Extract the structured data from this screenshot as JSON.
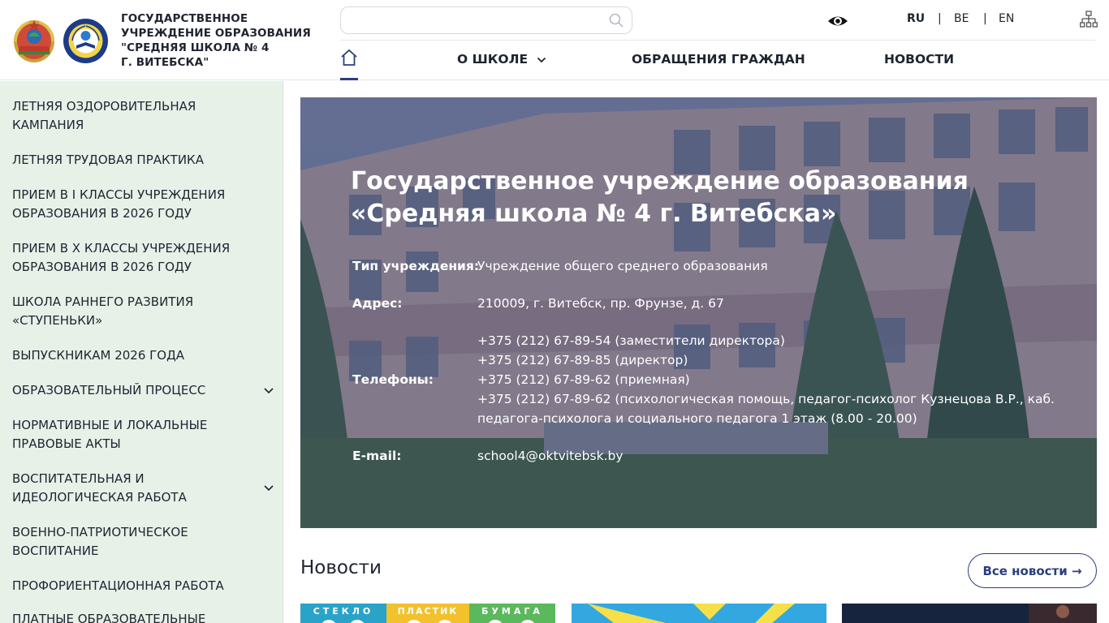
{
  "header": {
    "brand_lines": [
      "ГОСУДАРСТВЕННОЕ",
      "УЧРЕЖДЕНИЕ ОБРАЗОВАНИЯ",
      "\"СРЕДНЯЯ ШКОЛА № 4",
      "Г. ВИТЕБСКА\""
    ],
    "search": {
      "placeholder": ""
    },
    "languages": [
      {
        "code": "RU",
        "active": true
      },
      {
        "code": "BE",
        "active": false
      },
      {
        "code": "EN",
        "active": false
      }
    ],
    "lang_separator": "|"
  },
  "nav": {
    "items": [
      {
        "label": "О ШКОЛЕ",
        "has_dropdown": true
      },
      {
        "label": "ОБРАЩЕНИЯ ГРАЖДАН",
        "has_dropdown": false
      },
      {
        "label": "НОВОСТИ",
        "has_dropdown": false
      }
    ]
  },
  "sidebar": {
    "items": [
      {
        "label": "ЛЕТНЯЯ ОЗДОРОВИТЕЛЬНАЯ КАМПАНИЯ",
        "expandable": false
      },
      {
        "label": "ЛЕТНЯЯ ТРУДОВАЯ ПРАКТИКА",
        "expandable": false
      },
      {
        "label": "ПРИЕМ В I КЛАССЫ УЧРЕЖДЕНИЯ ОБРАЗОВАНИЯ В 2026 ГОДУ",
        "expandable": false
      },
      {
        "label": "ПРИЕМ В Х КЛАССЫ УЧРЕЖДЕНИЯ ОБРАЗОВАНИЯ В 2026 ГОДУ",
        "expandable": false
      },
      {
        "label": "ШКОЛА РАННЕГО РАЗВИТИЯ «СТУПЕНЬКИ»",
        "expandable": false
      },
      {
        "label": "ВЫПУСКНИКАМ 2026 ГОДА",
        "expandable": false
      },
      {
        "label": "ОБРАЗОВАТЕЛЬНЫЙ ПРОЦЕСС",
        "expandable": true
      },
      {
        "label": "НОРМАТИВНЫЕ И ЛОКАЛЬНЫЕ ПРАВОВЫЕ АКТЫ",
        "expandable": false
      },
      {
        "label": "ВОСПИТАТЕЛЬНАЯ И ИДЕОЛОГИЧЕСКАЯ РАБОТА",
        "expandable": true
      },
      {
        "label": "ВОЕННО-ПАТРИОТИЧЕСКОЕ ВОСПИТАНИЕ",
        "expandable": false
      },
      {
        "label": "ПРОФОРИЕНТАЦИОННАЯ РАБОТА",
        "expandable": false
      },
      {
        "label": "ПЛАТНЫЕ ОБРАЗОВАТЕЛЬНЫЕ УСЛУГИ",
        "expandable": false
      }
    ]
  },
  "hero": {
    "title_lines": [
      "Государственное учреждение образования",
      "«Средняя школа № 4 г. Витебска»"
    ],
    "type_label": "Тип учреждения:",
    "type_value": "Учреждение общего среднего образования",
    "address_label": "Адрес:",
    "address_value": "210009, г. Витебск, пр. Фрунзе, д. 67",
    "phones_label": "Телефоны:",
    "phones": [
      "+375 (212) 67-89-54 (заместители директора)",
      "+375 (212) 67-89-85 (директор)",
      "+375 (212) 67-89-62 (приемная)",
      "+375 (212) 67-89-62 (психологическая помощь, педагог-психолог Кузнецова В.Р., каб.",
      "педагога-психолога и социального педагога 1 этаж (8.00 - 20.00)"
    ],
    "email_label": "E-mail:",
    "email_value": "school4@oktvitebsk.by"
  },
  "news": {
    "title": "Новости",
    "all_label": "Все новости →",
    "card1_words": [
      "СТЕКЛО",
      "ПЛАСТИК",
      "БУМАГА"
    ]
  },
  "colors": {
    "accent": "#2a3f7e",
    "sidebar_bg": "#e8f1e8"
  }
}
